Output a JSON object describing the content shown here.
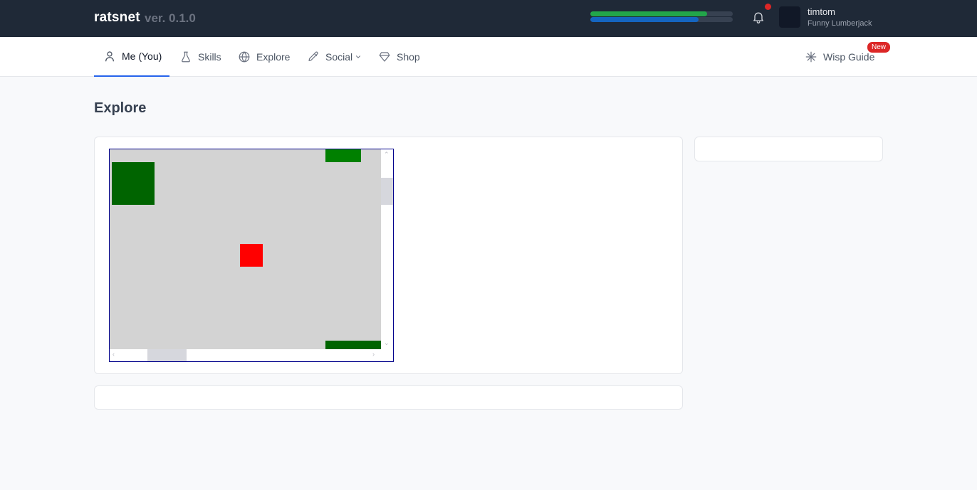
{
  "app": {
    "brand": "ratsnet",
    "version": "ver. 0.1.0"
  },
  "status_bars": {
    "xp": {
      "fraction": 0.82,
      "color": "#22a64a"
    },
    "hp": {
      "fraction": 0.76,
      "color": "#1565c0"
    }
  },
  "notifications": {
    "has_unread": true,
    "icon": "bell-icon"
  },
  "user": {
    "name": "timtom",
    "title": "Funny Lumberjack"
  },
  "nav": {
    "me": {
      "label": "Me (You)",
      "icon": "user-icon"
    },
    "skills": {
      "label": "Skills",
      "icon": "flask-icon"
    },
    "explore": {
      "label": "Explore",
      "icon": "globe-icon"
    },
    "social": {
      "label": "Social",
      "icon": "pencil-icon"
    },
    "shop": {
      "label": "Shop",
      "icon": "diamond-icon"
    },
    "wisp": {
      "label": "Wisp Guide",
      "icon": "sparkle-icon",
      "badge": "New"
    }
  },
  "page": {
    "title": "Explore"
  },
  "map": {
    "tile_colors": {
      "tree": "#006400",
      "tree_light": "#008000",
      "player": "#ff0000",
      "ground": "#d3d3d3"
    }
  }
}
